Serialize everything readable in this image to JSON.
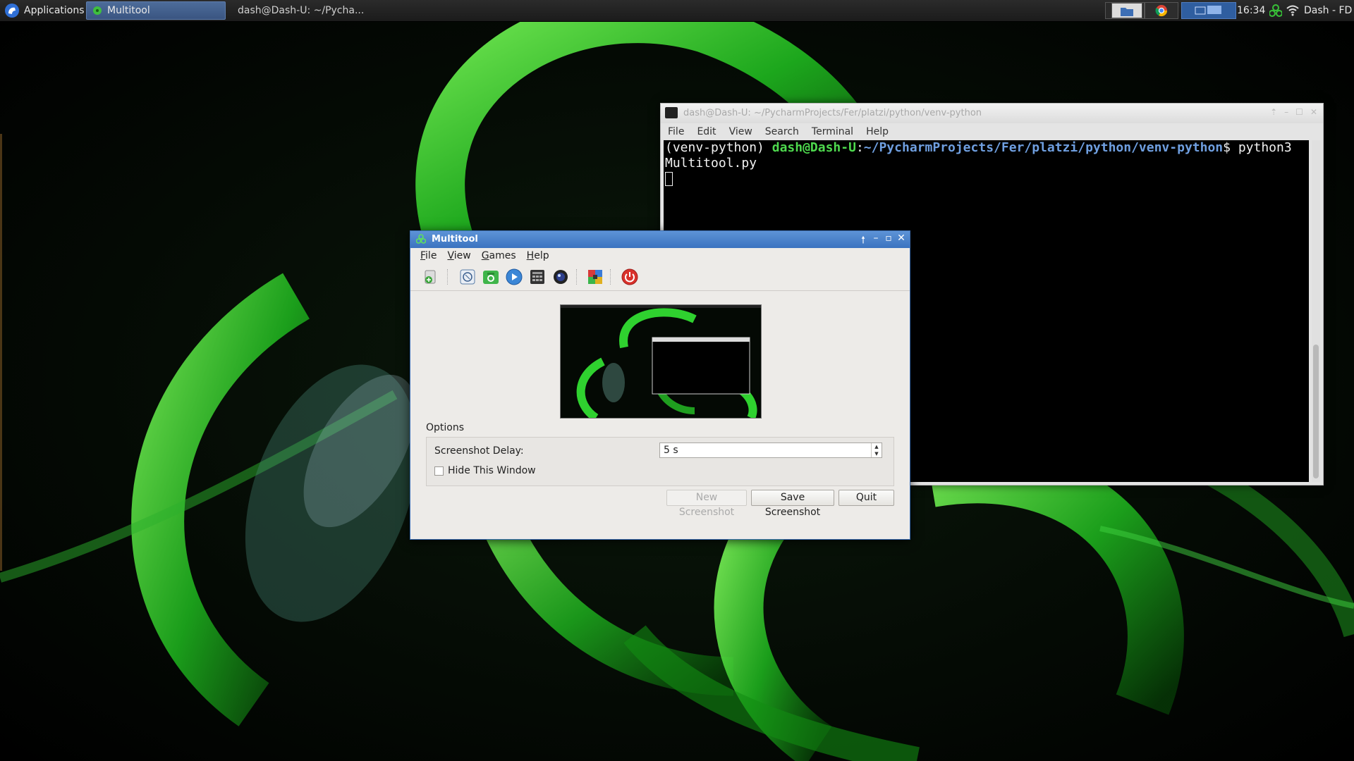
{
  "panel": {
    "applications_label": "Applications",
    "tasks": [
      {
        "label": "Multitool",
        "active": true
      },
      {
        "label": "dash@Dash-U: ~/Pycha...",
        "active": false
      }
    ],
    "clock": "16:34",
    "user": "Dash - FD",
    "icons": [
      "xfce-mouse-icon",
      "multitool-app-icon",
      "terminal-icon",
      "file-manager-icon",
      "chrome-icon",
      "workspace-switcher-icon",
      "biohazard-tray-icon",
      "wifi-icon"
    ]
  },
  "terminal": {
    "title": "dash@Dash-U: ~/PycharmProjects/Fer/platzi/python/venv-python",
    "menu": [
      "File",
      "Edit",
      "View",
      "Search",
      "Terminal",
      "Help"
    ],
    "prompt_env": "(venv-python)",
    "prompt_user": "dash@Dash-U",
    "prompt_colon": ":",
    "prompt_path": "~/PycharmProjects/Fer/platzi/python/venv-python",
    "prompt_cmd": "$ python3",
    "line2": "Multitool.py",
    "colors": {
      "user": "#4ed94e",
      "path": "#6f9fe0"
    }
  },
  "multitool": {
    "title": "Multitool",
    "menu": [
      "File",
      "View",
      "Games",
      "Help"
    ],
    "toolbar_icons": [
      "install-icon",
      "clipboard-icon",
      "camera-icon",
      "play-icon",
      "calculator-icon",
      "webcam-icon",
      "color-grid-icon",
      "power-icon"
    ],
    "options_label": "Options",
    "delay_label": "Screenshot Delay:",
    "delay_value": "5 s",
    "hide_label": "Hide This Window",
    "hide_checked": false,
    "buttons": {
      "new": "New Screenshot",
      "save": "Save Screenshot",
      "quit": "Quit"
    },
    "accent": "#3b73c0"
  }
}
